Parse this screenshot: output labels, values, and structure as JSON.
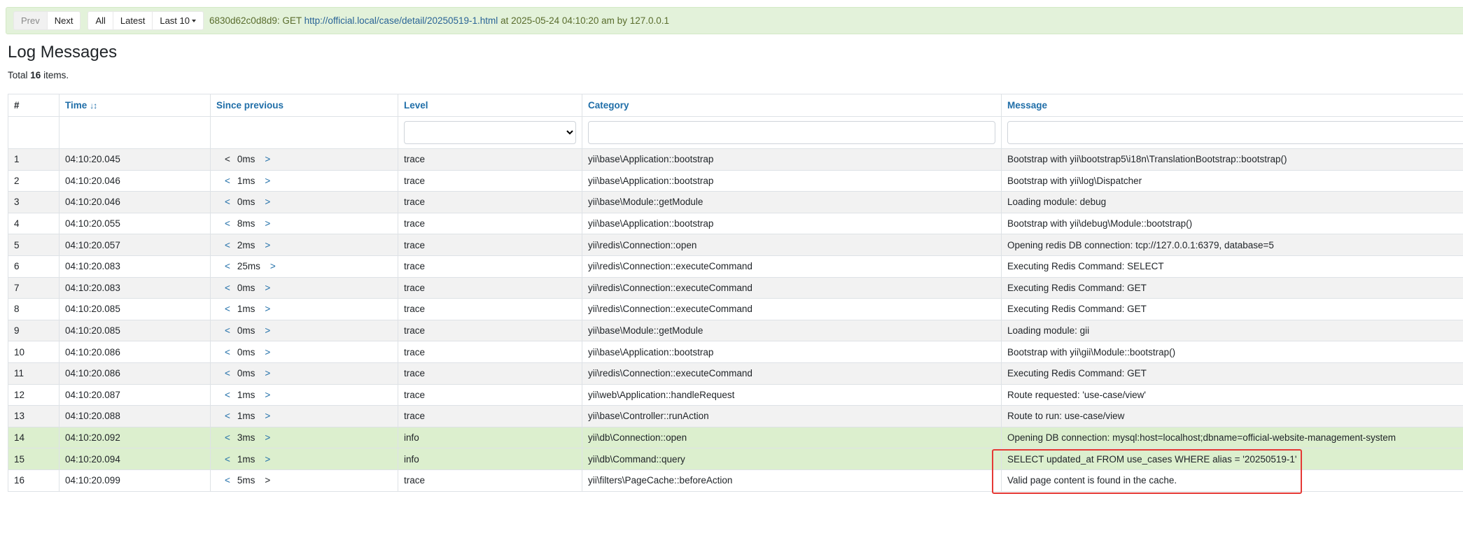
{
  "toolbar": {
    "buttons_group1": [
      "Prev",
      "Next"
    ],
    "buttons_group2": [
      "All",
      "Latest"
    ],
    "last_button": "Last 10",
    "request_id": "6830d62c0d8d9: GET",
    "request_url": "http://official.local/case/detail/20250519-1.html",
    "request_suffix": "at 2025-05-24 04:10:20 am by 127.0.0.1"
  },
  "page": {
    "title": "Log Messages",
    "summary_prefix": "Total",
    "summary_count": "16",
    "summary_suffix": "items."
  },
  "columns": {
    "num": "#",
    "time": "Time",
    "since": "Since previous",
    "level": "Level",
    "category": "Category",
    "message": "Message"
  },
  "rows": [
    {
      "num": "1",
      "time": "04:10:20.045",
      "since": "0ms",
      "level": "trace",
      "category": "yii\\base\\Application::bootstrap",
      "message": "Bootstrap with yii\\bootstrap5\\i18n\\TranslationBootstrap::bootstrap()",
      "info": false
    },
    {
      "num": "2",
      "time": "04:10:20.046",
      "since": "1ms",
      "level": "trace",
      "category": "yii\\base\\Application::bootstrap",
      "message": "Bootstrap with yii\\log\\Dispatcher",
      "info": false
    },
    {
      "num": "3",
      "time": "04:10:20.046",
      "since": "0ms",
      "level": "trace",
      "category": "yii\\base\\Module::getModule",
      "message": "Loading module: debug",
      "info": false
    },
    {
      "num": "4",
      "time": "04:10:20.055",
      "since": "8ms",
      "level": "trace",
      "category": "yii\\base\\Application::bootstrap",
      "message": "Bootstrap with yii\\debug\\Module::bootstrap()",
      "info": false
    },
    {
      "num": "5",
      "time": "04:10:20.057",
      "since": "2ms",
      "level": "trace",
      "category": "yii\\redis\\Connection::open",
      "message": "Opening redis DB connection: tcp://127.0.0.1:6379, database=5",
      "info": false
    },
    {
      "num": "6",
      "time": "04:10:20.083",
      "since": "25ms",
      "level": "trace",
      "category": "yii\\redis\\Connection::executeCommand",
      "message": "Executing Redis Command: SELECT",
      "info": false
    },
    {
      "num": "7",
      "time": "04:10:20.083",
      "since": "0ms",
      "level": "trace",
      "category": "yii\\redis\\Connection::executeCommand",
      "message": "Executing Redis Command: GET",
      "info": false
    },
    {
      "num": "8",
      "time": "04:10:20.085",
      "since": "1ms",
      "level": "trace",
      "category": "yii\\redis\\Connection::executeCommand",
      "message": "Executing Redis Command: GET",
      "info": false
    },
    {
      "num": "9",
      "time": "04:10:20.085",
      "since": "0ms",
      "level": "trace",
      "category": "yii\\base\\Module::getModule",
      "message": "Loading module: gii",
      "info": false
    },
    {
      "num": "10",
      "time": "04:10:20.086",
      "since": "0ms",
      "level": "trace",
      "category": "yii\\base\\Application::bootstrap",
      "message": "Bootstrap with yii\\gii\\Module::bootstrap()",
      "info": false
    },
    {
      "num": "11",
      "time": "04:10:20.086",
      "since": "0ms",
      "level": "trace",
      "category": "yii\\redis\\Connection::executeCommand",
      "message": "Executing Redis Command: GET",
      "info": false
    },
    {
      "num": "12",
      "time": "04:10:20.087",
      "since": "1ms",
      "level": "trace",
      "category": "yii\\web\\Application::handleRequest",
      "message": "Route requested: 'use-case/view'",
      "info": false
    },
    {
      "num": "13",
      "time": "04:10:20.088",
      "since": "1ms",
      "level": "trace",
      "category": "yii\\base\\Controller::runAction",
      "message": "Route to run: use-case/view",
      "info": false
    },
    {
      "num": "14",
      "time": "04:10:20.092",
      "since": "3ms",
      "level": "info",
      "category": "yii\\db\\Connection::open",
      "message": "Opening DB connection: mysql:host=localhost;dbname=official-website-management-system",
      "info": true
    },
    {
      "num": "15",
      "time": "04:10:20.094",
      "since": "1ms",
      "level": "info",
      "category": "yii\\db\\Command::query",
      "message": "SELECT updated_at FROM use_cases WHERE alias = '20250519-1'",
      "info": true
    },
    {
      "num": "16",
      "time": "04:10:20.099",
      "since": "5ms",
      "level": "trace",
      "category": "yii\\filters\\PageCache::beforeAction",
      "message": "Valid page content is found in the cache.",
      "info": false
    }
  ],
  "nav": {
    "prev": "<",
    "next": ">"
  },
  "colors": {
    "link": "#1f6ea8",
    "info_row": "#dcefce",
    "highlight": "#e53935"
  }
}
